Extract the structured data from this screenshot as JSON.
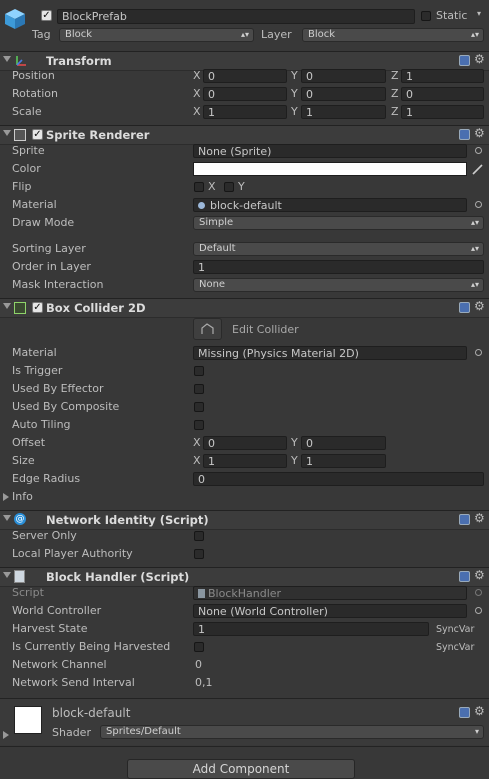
{
  "object": {
    "name": "BlockPrefab",
    "static_label": "Static",
    "tag_label": "Tag",
    "tag_value": "Block",
    "layer_label": "Layer",
    "layer_value": "Block"
  },
  "transform": {
    "title": "Transform",
    "rows": [
      {
        "label": "Position",
        "x": "0",
        "y": "0",
        "z": "1"
      },
      {
        "label": "Rotation",
        "x": "0",
        "y": "0",
        "z": "0"
      },
      {
        "label": "Scale",
        "x": "1",
        "y": "1",
        "z": "1"
      }
    ]
  },
  "axes": {
    "x": "X",
    "y": "Y",
    "z": "Z"
  },
  "sprite_renderer": {
    "title": "Sprite Renderer",
    "sprite_label": "Sprite",
    "sprite_value": "None (Sprite)",
    "color_label": "Color",
    "flip_label": "Flip",
    "flip_x": "X",
    "flip_y": "Y",
    "material_label": "Material",
    "material_value": "block-default",
    "draw_mode_label": "Draw Mode",
    "draw_mode_value": "Simple",
    "sorting_layer_label": "Sorting Layer",
    "sorting_layer_value": "Default",
    "order_label": "Order in Layer",
    "order_value": "1",
    "mask_label": "Mask Interaction",
    "mask_value": "None"
  },
  "box_collider": {
    "title": "Box Collider 2D",
    "edit_label": "Edit Collider",
    "material_label": "Material",
    "material_value": "Missing (Physics Material 2D)",
    "is_trigger": "Is Trigger",
    "used_by_effector": "Used By Effector",
    "used_by_composite": "Used By Composite",
    "auto_tiling": "Auto Tiling",
    "offset_label": "Offset",
    "offset_x": "0",
    "offset_y": "0",
    "size_label": "Size",
    "size_x": "1",
    "size_y": "1",
    "edge_radius_label": "Edge Radius",
    "edge_radius_value": "0",
    "info_label": "Info"
  },
  "network_identity": {
    "title": "Network Identity (Script)",
    "server_only": "Server Only",
    "local_player": "Local Player Authority"
  },
  "block_handler": {
    "title": "Block Handler (Script)",
    "script_label": "Script",
    "script_value": "BlockHandler",
    "world_controller_label": "World Controller",
    "world_controller_value": "None (World Controller)",
    "harvest_state_label": "Harvest State",
    "harvest_state_value": "1",
    "harvest_sync": "SyncVar",
    "being_harvested_label": "Is Currently Being Harvested",
    "being_harvested_sync": "SyncVar",
    "network_channel_label": "Network Channel",
    "network_channel_value": "0",
    "network_interval_label": "Network Send Interval",
    "network_interval_value": "0,1"
  },
  "material_preview": {
    "name": "block-default",
    "shader_label": "Shader",
    "shader_value": "Sprites/Default"
  },
  "add_component": "Add Component",
  "colors": {
    "panel": "#383838",
    "field": "#2a2a2a",
    "white": "#ffffff"
  }
}
